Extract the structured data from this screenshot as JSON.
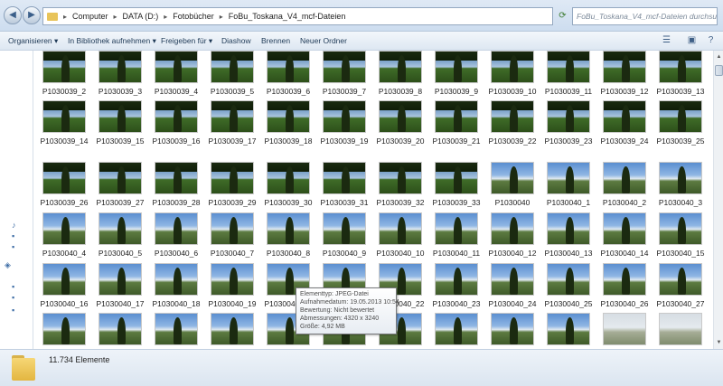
{
  "address": {
    "path": [
      "Computer",
      "DATA (D:)",
      "Fotobücher",
      "FoBu_Toskana_V4_mcf-Dateien"
    ],
    "search_placeholder": "FoBu_Toskana_V4_mcf-Dateien durchsuchen"
  },
  "toolbar": {
    "items": [
      "Organisieren",
      "In Bibliothek aufnehmen",
      "Freigeben für",
      "Diashow",
      "Brennen",
      "Neuer Ordner"
    ]
  },
  "files": [
    {
      "name": "P1030039_2",
      "look": "dark"
    },
    {
      "name": "P1030039_3",
      "look": "dark"
    },
    {
      "name": "P1030039_4",
      "look": "dark"
    },
    {
      "name": "P1030039_5",
      "look": "dark"
    },
    {
      "name": "P1030039_6",
      "look": "dark"
    },
    {
      "name": "P1030039_7",
      "look": "dark"
    },
    {
      "name": "P1030039_8",
      "look": "dark"
    },
    {
      "name": "P1030039_9",
      "look": "dark"
    },
    {
      "name": "P1030039_10",
      "look": "dark"
    },
    {
      "name": "P1030039_11",
      "look": "dark"
    },
    {
      "name": "P1030039_12",
      "look": "dark"
    },
    {
      "name": "P1030039_13",
      "look": "dark"
    },
    {
      "name": "P1030039_14",
      "look": "dark"
    },
    {
      "name": "P1030039_15",
      "look": "dark"
    },
    {
      "name": "P1030039_16",
      "look": "dark"
    },
    {
      "name": "P1030039_17",
      "look": "dark"
    },
    {
      "name": "P1030039_18",
      "look": "dark"
    },
    {
      "name": "P1030039_19",
      "look": "dark"
    },
    {
      "name": "P1030039_20",
      "look": "dark"
    },
    {
      "name": "P1030039_21",
      "look": "dark"
    },
    {
      "name": "P1030039_22",
      "look": "dark"
    },
    {
      "name": "P1030039_23",
      "look": "dark"
    },
    {
      "name": "P1030039_24",
      "look": "dark"
    },
    {
      "name": "P1030039_25",
      "look": "dark"
    },
    {
      "name": "P1030039_26",
      "look": "dark"
    },
    {
      "name": "P1030039_27",
      "look": "dark"
    },
    {
      "name": "P1030039_28",
      "look": "dark"
    },
    {
      "name": "P1030039_29",
      "look": "dark"
    },
    {
      "name": "P1030039_30",
      "look": "dark"
    },
    {
      "name": "P1030039_31",
      "look": "dark"
    },
    {
      "name": "P1030039_32",
      "look": "dark"
    },
    {
      "name": "P1030039_33",
      "look": "dark"
    },
    {
      "name": "P1030040",
      "look": "blue"
    },
    {
      "name": "P1030040_1",
      "look": "blue"
    },
    {
      "name": "P1030040_2",
      "look": "blue"
    },
    {
      "name": "P1030040_3",
      "look": "blue"
    },
    {
      "name": "P1030040_4",
      "look": "blue"
    },
    {
      "name": "P1030040_5",
      "look": "blue"
    },
    {
      "name": "P1030040_6",
      "look": "blue"
    },
    {
      "name": "P1030040_7",
      "look": "blue"
    },
    {
      "name": "P1030040_8",
      "look": "blue"
    },
    {
      "name": "P1030040_9",
      "look": "blue"
    },
    {
      "name": "P1030040_10",
      "look": "blue"
    },
    {
      "name": "P1030040_11",
      "look": "blue"
    },
    {
      "name": "P1030040_12",
      "look": "blue"
    },
    {
      "name": "P1030040_13",
      "look": "blue"
    },
    {
      "name": "P1030040_14",
      "look": "blue"
    },
    {
      "name": "P1030040_15",
      "look": "blue"
    },
    {
      "name": "P1030040_16",
      "look": "blue"
    },
    {
      "name": "P1030040_17",
      "look": "blue"
    },
    {
      "name": "P1030040_18",
      "look": "blue"
    },
    {
      "name": "P1030040_19",
      "look": "blue"
    },
    {
      "name": "P1030040_20",
      "look": "blue"
    },
    {
      "name": "P1030040_21",
      "look": "blue"
    },
    {
      "name": "P1030040_22",
      "look": "blue"
    },
    {
      "name": "P1030040_23",
      "look": "blue"
    },
    {
      "name": "P1030040_24",
      "look": "blue"
    },
    {
      "name": "P1030040_25",
      "look": "blue"
    },
    {
      "name": "P1030040_26",
      "look": "blue"
    },
    {
      "name": "P1030040_27",
      "look": "blue"
    },
    {
      "name": "",
      "look": "blue"
    },
    {
      "name": "",
      "look": "blue"
    },
    {
      "name": "",
      "look": "blue"
    },
    {
      "name": "",
      "look": "blue"
    },
    {
      "name": "",
      "look": "blue"
    },
    {
      "name": "",
      "look": "blue"
    },
    {
      "name": "",
      "look": "blue"
    },
    {
      "name": "",
      "look": "blue"
    },
    {
      "name": "",
      "look": "blue"
    },
    {
      "name": "",
      "look": "blue"
    },
    {
      "name": "",
      "look": "pale"
    },
    {
      "name": "",
      "look": "pale"
    }
  ],
  "tooltip": {
    "lines": [
      "Elementtyp: JPEG-Datei",
      "Aufnahmedatum: 19.05.2013 10:54",
      "Bewertung: Nicht bewertet",
      "Abmessungen: 4320 x 3240",
      "Größe: 4,92 MB"
    ]
  },
  "status": {
    "count": "11.734 Elemente"
  }
}
